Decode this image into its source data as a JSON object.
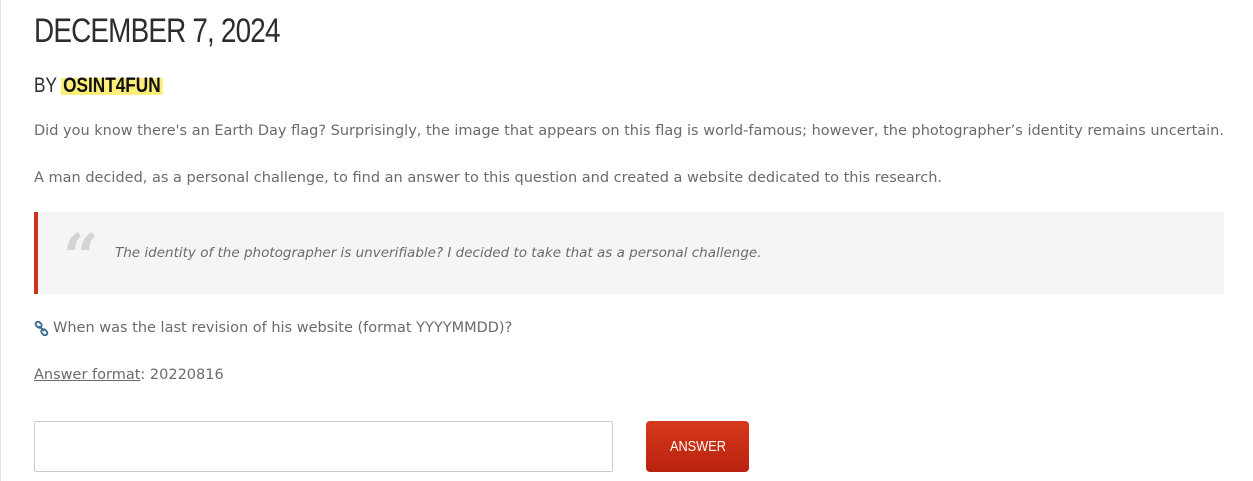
{
  "post": {
    "date": "DECEMBER 7, 2024",
    "by_label": "BY",
    "author": "OSINT4FUN",
    "paragraphs": [
      "Did you know there's an Earth Day flag? Surprisingly, the image that appears on this flag is world-famous; however, the photographer’s identity remains uncertain.",
      "A man decided, as a personal challenge, to find an answer to this question and created a website dedicated to this research."
    ],
    "quote": {
      "icon": "quote-icon",
      "text": "The identity of the photographer is unverifiable? I decided to take that as a personal challenge."
    },
    "question": {
      "icon": "link-icon",
      "text": "When was the last revision of his website (format YYYYMMDD)?"
    },
    "answer_format": {
      "label": "Answer format",
      "separator": ": ",
      "value": "20220816"
    }
  },
  "form": {
    "input_value": "",
    "input_placeholder": "",
    "button_label": "ANSWER"
  },
  "colors": {
    "accent": "#c9341a",
    "button": "#c92d16",
    "highlight": "#fbef7a",
    "text": "#6b6b6b",
    "heading": "#2d2d2d",
    "link_icon": "#3d6b8c"
  }
}
